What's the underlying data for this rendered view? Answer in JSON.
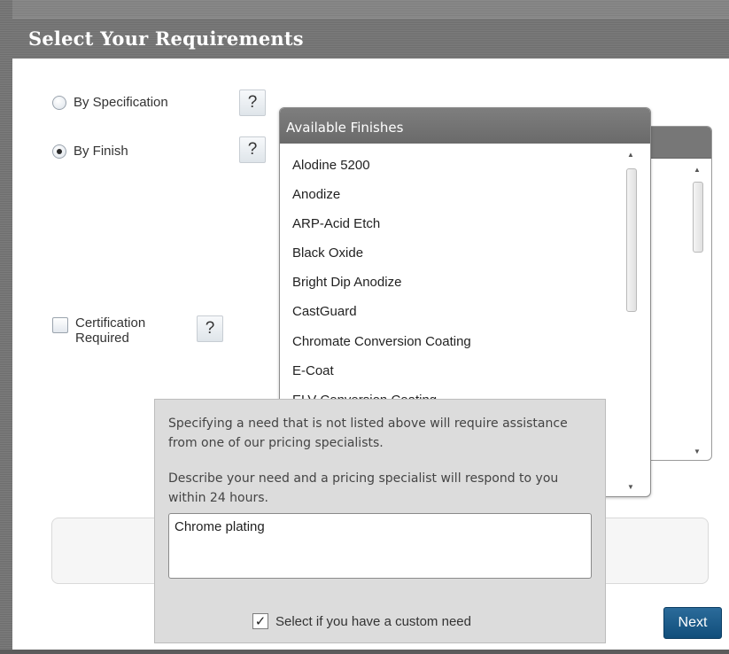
{
  "header": {
    "title": "Select Your Requirements"
  },
  "options": {
    "by_specification": "By Specification",
    "by_finish": "By Finish",
    "certification_line1": "Certification",
    "certification_line2": "Required",
    "help": "?"
  },
  "finishes": {
    "header": "Available Finishes",
    "items": [
      "Alodine 5200",
      "Anodize",
      "ARP-Acid Etch",
      "Black Oxide",
      "Bright Dip Anodize",
      "CastGuard",
      "Chromate Conversion Coating",
      "E-Coat",
      "ELV Conversion Coating"
    ]
  },
  "popup": {
    "text1": "Specifying a need that is not listed above will require assistance from one of our pricing specialists.",
    "text2": "Describe your need and a pricing specialist will respond to you within 24 hours.",
    "input_value": "Chrome plating",
    "custom_need_label": "Select if you have a custom need",
    "checkmark": "✓"
  },
  "buttons": {
    "next": "Next"
  },
  "scroll_arrows": {
    "up": "▲",
    "down": "▼"
  },
  "icons": {
    "radio": "radio-icon",
    "checkbox": "checkbox-icon",
    "help": "question-icon"
  },
  "colors": {
    "accent": "#1f5f8f",
    "header_bg": "#777777"
  },
  "state": {
    "selected_option": "By Finish",
    "certification_required": false,
    "custom_need_checked": true
  }
}
